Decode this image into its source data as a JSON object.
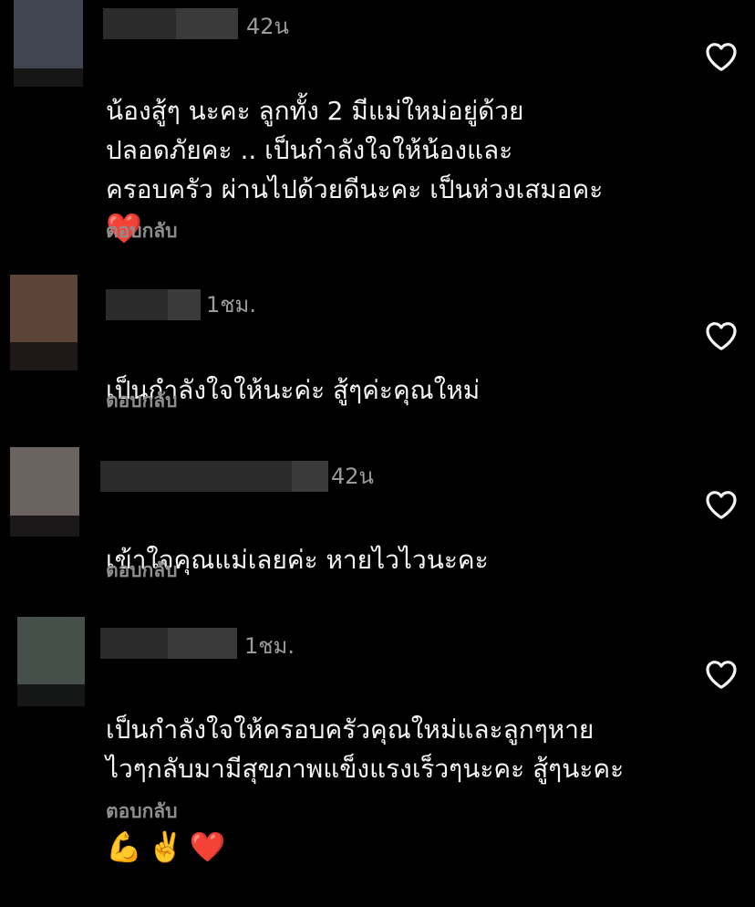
{
  "comments": [
    {
      "time": "42น",
      "text": "น้องสู้ๆ นะคะ ลูกทั้ง 2 มีแม่ใหม่อยู่ด้วย\nปลอดภัยคะ .. เป็นกำลังใจให้น้องและ\nครอบครัว ผ่านไปด้วยดีนะคะ เป็นห่วงเสมอคะ",
      "emoji": [
        "❤️"
      ],
      "reply_label": "ตอบกลับ",
      "like_icon": "heart-outline-icon",
      "avatar_color": "#404550"
    },
    {
      "time": "1ชม.",
      "text": "เป็นกำลังใจให้นะค่ะ สู้ๆค่ะคุณใหม่",
      "emoji": [],
      "reply_label": "ตอบกลับ",
      "like_icon": "heart-outline-icon",
      "avatar_color": "#5d4438"
    },
    {
      "time": "42น",
      "text": "เข้าใจคุณแม่เลยค่ะ หายไวไวนะคะ",
      "emoji": [],
      "reply_label": "ตอบกลับ",
      "like_icon": "heart-outline-icon",
      "avatar_color": "#6b6360"
    },
    {
      "time": "1ชม.",
      "text": "เป็นกำลังใจให้ครอบครัวคุณใหม่และลูกๆหาย\nไวๆกลับมามีสุขภาพแข็งแรงเร็วๆนะคะ สู้ๆนะคะ",
      "emoji": [
        "💪",
        "✌️",
        "❤️"
      ],
      "reply_label": "ตอบกลับ",
      "like_icon": "heart-outline-icon",
      "avatar_color": "#46504a"
    }
  ],
  "colors": {
    "background": "#000000",
    "text_primary": "#f5f5f5",
    "text_secondary": "#8e8e8e",
    "redacted": "#2b2b2b"
  }
}
